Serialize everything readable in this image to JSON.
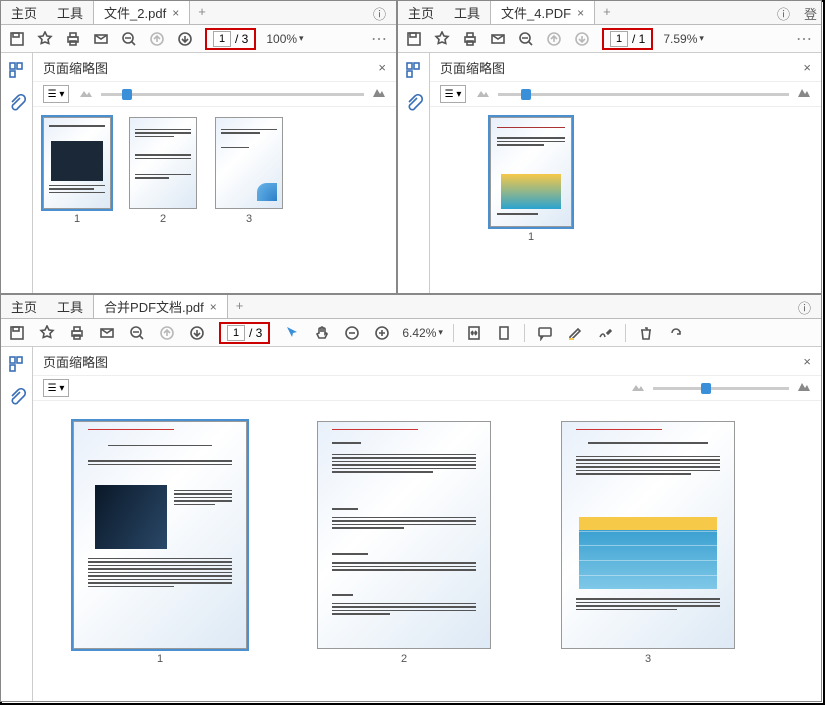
{
  "tl": {
    "tabs": {
      "home": "主页",
      "tools": "工具",
      "file": "文件_2.pdf"
    },
    "page": {
      "cur": "1",
      "total": "/ 3"
    },
    "zoom": "100%",
    "panel": "页面缩略图",
    "thumbs": [
      "1",
      "2",
      "3"
    ]
  },
  "tr": {
    "tabs": {
      "home": "主页",
      "tools": "工具",
      "file": "文件_4.PDF"
    },
    "page": {
      "cur": "1",
      "total": "/ 1"
    },
    "zoom": "7.59%",
    "panel": "页面缩略图",
    "thumbs": [
      "1"
    ]
  },
  "b": {
    "tabs": {
      "home": "主页",
      "tools": "工具",
      "file": "合并PDF文档.pdf"
    },
    "page": {
      "cur": "1",
      "total": "/ 3"
    },
    "zoom": "6.42%",
    "panel": "页面缩略图",
    "thumbs": [
      "1",
      "2",
      "3"
    ]
  }
}
